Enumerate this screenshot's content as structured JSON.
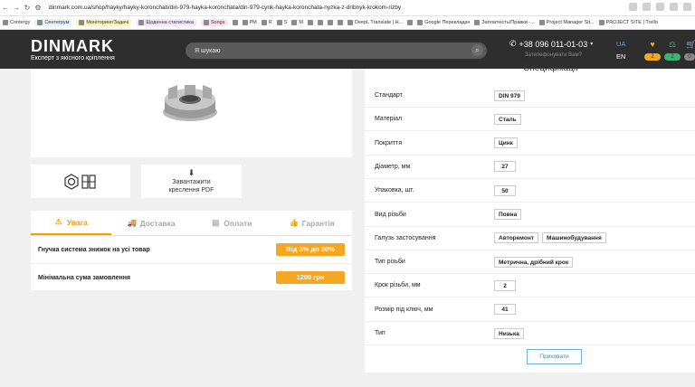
{
  "browser": {
    "url": "dinmark.com.ua/shop/hayky/hayky-koronchati/din-979-hayka-koronchata/din-979-cynk-hayka-koronchata-nyzka-z-dribnyk-krokom-rizby",
    "bookmarks": [
      "Contergy",
      "Сентегрум",
      "Моніторинг/Задачі",
      "Щоденна статистика",
      "Songs",
      "",
      "PM",
      "R",
      "S",
      "M",
      "",
      "",
      "",
      "",
      "DeepL Translate | Н...",
      "",
      "Google Перекладач",
      "Заплатність/Правки -...",
      "Project Manager Sit...",
      "PROJECT SITE | Trello"
    ]
  },
  "header": {
    "logo": "DINMARK",
    "tagline": "Експерт з якісного кріплення",
    "search_placeholder": "Я шукаю",
    "phone": "+38 096 011-01-03",
    "callback": "Зателефонувати Вам?",
    "lang_active": "UA",
    "lang_other": "EN",
    "favorites_count": "2",
    "compare_count": "2",
    "cart_count": "0"
  },
  "product": {
    "pdf_label": "Завантажити креслення PDF"
  },
  "info": {
    "tabs": [
      {
        "label": "Увага",
        "icon": "warning-icon"
      },
      {
        "label": "Доставка",
        "icon": "truck-icon"
      },
      {
        "label": "Оплати",
        "icon": "wallet-icon"
      },
      {
        "label": "Гарантія",
        "icon": "thumbs-up-icon"
      }
    ],
    "rows": [
      {
        "label": "Гнучка система знижок на усі товар",
        "value": "Від 3% до 30%"
      },
      {
        "label": "Мінімальна сума замовлення",
        "value": "1200 грн"
      }
    ]
  },
  "spec": {
    "title": "Специфікації",
    "rows": [
      {
        "key": "Стандарт",
        "values": [
          "DIN 979"
        ]
      },
      {
        "key": "Матеріал",
        "values": [
          "Сталь"
        ]
      },
      {
        "key": "Покриття",
        "values": [
          "Цинк"
        ]
      },
      {
        "key": "Діаметр, мм",
        "values": [
          "27"
        ]
      },
      {
        "key": "Упаковка, шт.",
        "values": [
          "50"
        ]
      },
      {
        "key": "Вид різьби",
        "values": [
          "Повна"
        ]
      },
      {
        "key": "Галузь застосування",
        "values": [
          "Авторемонт",
          "Машинобудування"
        ]
      },
      {
        "key": "Тип різьби",
        "values": [
          "Метрична, дрібний крок"
        ]
      },
      {
        "key": "Крок різьби, мм",
        "values": [
          "2"
        ]
      },
      {
        "key": "Розмір під ключ, мм",
        "values": [
          "41"
        ]
      },
      {
        "key": "Тип",
        "values": [
          "Низька"
        ]
      }
    ],
    "hide_label": "Приховати"
  },
  "colors": {
    "accent": "#f5a623",
    "header_bg": "#2e2e2e",
    "link": "#3a8ac0"
  }
}
